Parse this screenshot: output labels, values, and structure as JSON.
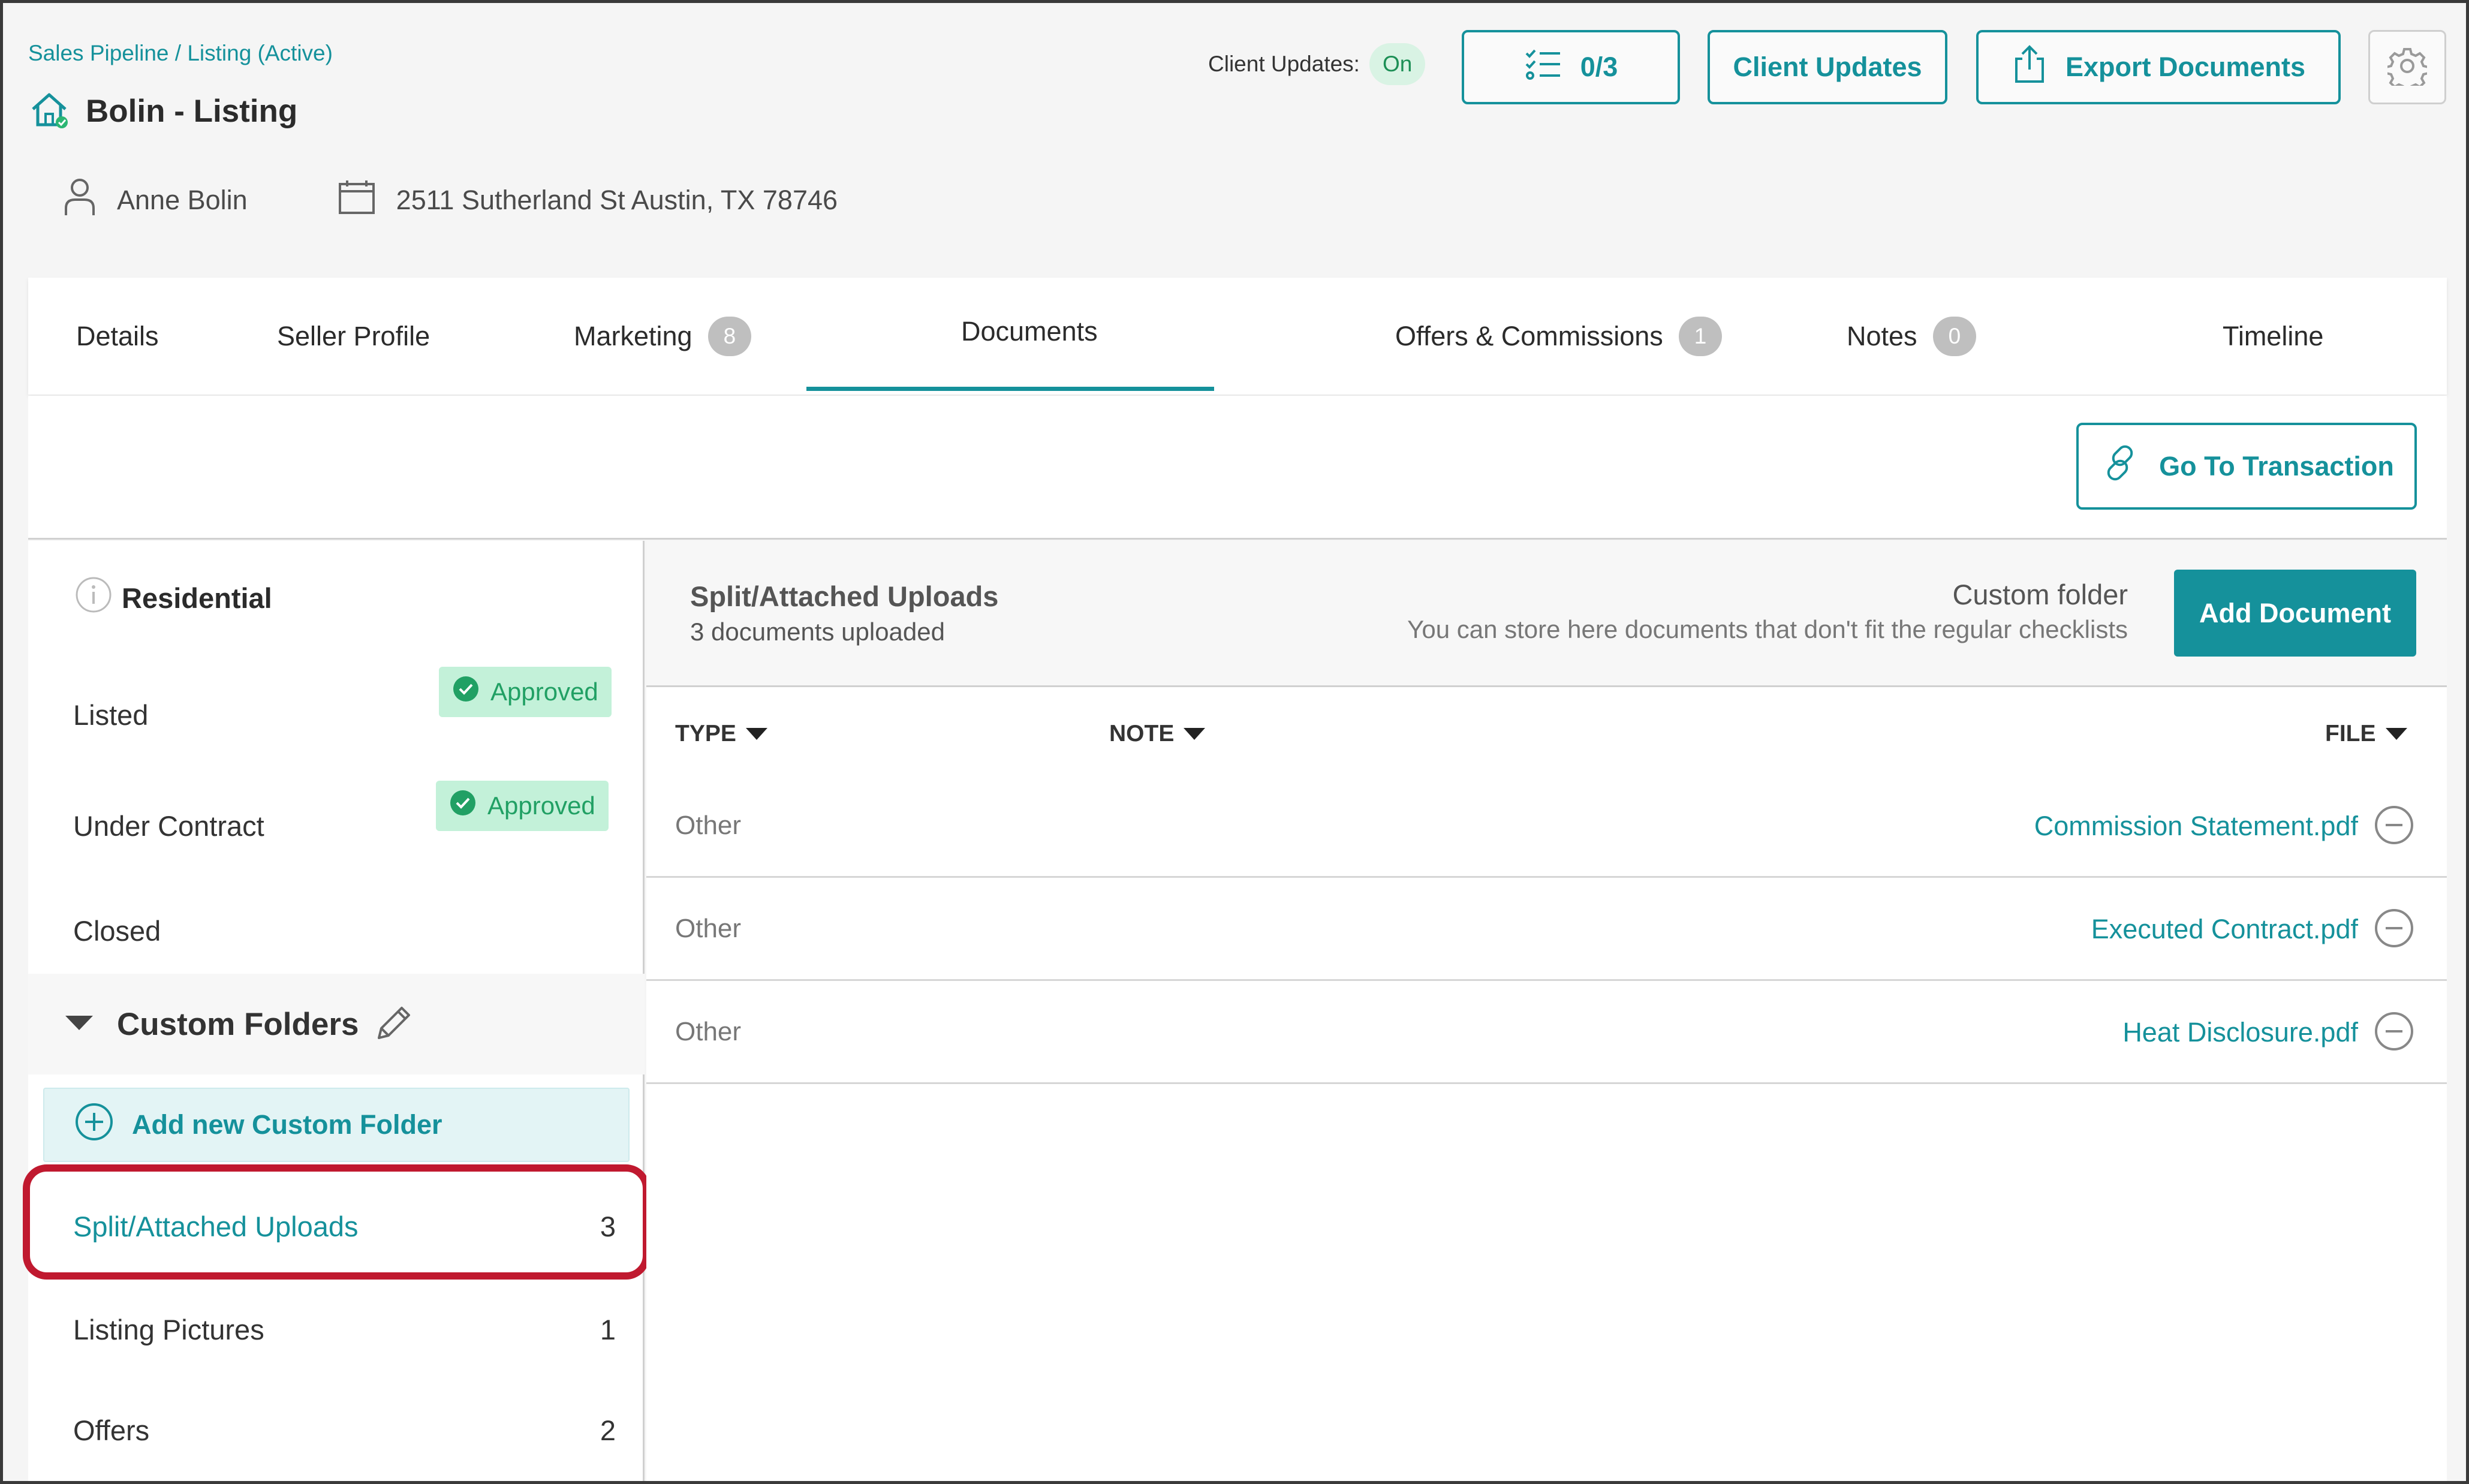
{
  "header": {
    "breadcrumb_root": "Sales Pipeline",
    "breadcrumb_sep": " / ",
    "breadcrumb_current": "Listing (Active)",
    "title": "Bolin - Listing",
    "client_name": "Anne Bolin",
    "address": "2511 Sutherland St Austin, TX 78746",
    "client_updates_label": "Client Updates:",
    "client_updates_state": "On",
    "checklist_progress": "0/3",
    "client_updates_button": "Client Updates",
    "export_button": "Export Documents"
  },
  "tabs": [
    {
      "label": "Details"
    },
    {
      "label": "Seller Profile"
    },
    {
      "label": "Marketing",
      "count": "8"
    },
    {
      "label": "Documents"
    },
    {
      "label": "Offers & Commissions",
      "count": "1"
    },
    {
      "label": "Notes",
      "count": "0"
    },
    {
      "label": "Timeline"
    }
  ],
  "active_tab": "Documents",
  "toolbar": {
    "go_to_transaction": "Go To Transaction"
  },
  "sidebar": {
    "checklist_title": "Residential",
    "stages": [
      {
        "label": "Listed",
        "status": "Approved"
      },
      {
        "label": "Under Contract",
        "status": "Approved"
      },
      {
        "label": "Closed",
        "status": ""
      }
    ],
    "custom_folders_title": "Custom Folders",
    "add_folder": "Add new Custom Folder",
    "folders": [
      {
        "name": "Split/Attached Uploads",
        "count": "3"
      },
      {
        "name": "Listing Pictures",
        "count": "1"
      },
      {
        "name": "Offers",
        "count": "2"
      }
    ]
  },
  "folder": {
    "title": "Split/Attached Uploads",
    "subtitle": "3 documents uploaded",
    "kind": "Custom folder",
    "description": "You can store here documents that don't fit the regular checklists",
    "add_button": "Add Document",
    "columns": {
      "type": "TYPE",
      "note": "NOTE",
      "file": "FILE"
    },
    "documents": [
      {
        "type": "Other",
        "note": "",
        "file": "Commission Statement.pdf"
      },
      {
        "type": "Other",
        "note": "",
        "file": "Executed Contract.pdf"
      },
      {
        "type": "Other",
        "note": "",
        "file": "Heat Disclosure.pdf"
      }
    ]
  },
  "colors": {
    "accent": "#15919b",
    "approved_bg": "#c3f1d9",
    "approved_text": "#21a064",
    "highlight": "#c0192f"
  }
}
